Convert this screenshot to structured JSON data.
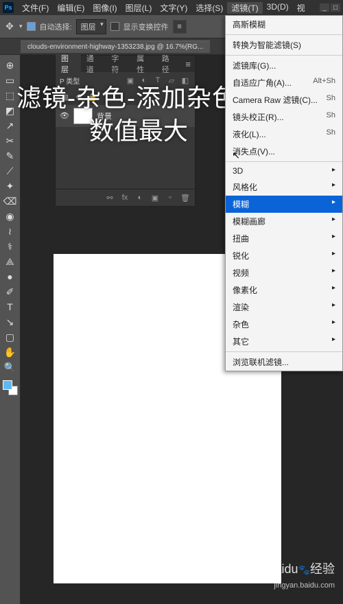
{
  "menubar": {
    "items": [
      "文件(F)",
      "编辑(E)",
      "图像(I)",
      "图层(L)",
      "文字(Y)",
      "选择(S)",
      "滤镜(T)",
      "3D(D)",
      "视"
    ],
    "active_index": 6
  },
  "optbar": {
    "auto_select": "自动选择:",
    "group": "图层",
    "show_transform": "显示变换控件"
  },
  "document_tab": "clouds-environment-highway-1353238.jpg @ 16.7%(RG...",
  "panel": {
    "tabs": [
      "图层",
      "通道",
      "字符",
      "属性",
      "路径"
    ],
    "kind": "Ρ 类型",
    "layer_name": "背景"
  },
  "dropdown": {
    "items": [
      {
        "label": "高斯模糊",
        "sep_after": true
      },
      {
        "label": "转换为智能滤镜(S)",
        "sep_after": true
      },
      {
        "label": "滤镜库(G)..."
      },
      {
        "label": "自适应广角(A)...",
        "shortcut": "Alt+Sh"
      },
      {
        "label": "Camera Raw 滤镜(C)...",
        "shortcut": "Sh"
      },
      {
        "label": "镜头校正(R)...",
        "shortcut": "Sh"
      },
      {
        "label": "液化(L)...",
        "shortcut": "Sh"
      },
      {
        "label": "消失点(V)...",
        "sep_after": true
      },
      {
        "label": "3D",
        "arrow": true
      },
      {
        "label": "风格化",
        "arrow": true
      },
      {
        "label": "模糊",
        "arrow": true,
        "highlight": true
      },
      {
        "label": "模糊画廊",
        "arrow": true
      },
      {
        "label": "扭曲",
        "arrow": true
      },
      {
        "label": "锐化",
        "arrow": true
      },
      {
        "label": "视频",
        "arrow": true
      },
      {
        "label": "像素化",
        "arrow": true
      },
      {
        "label": "渲染",
        "arrow": true
      },
      {
        "label": "杂色",
        "arrow": true
      },
      {
        "label": "其它",
        "arrow": true,
        "sep_after": true
      },
      {
        "label": "浏览联机滤镜..."
      }
    ]
  },
  "overlay": {
    "line1": "滤镜-杂色-添加杂色",
    "line2": "数值最大"
  },
  "watermark": {
    "brand": "Baidu",
    "label": "经验",
    "url": "jingyan.baidu.com"
  },
  "tools": [
    "⊕",
    "▭",
    "⬚",
    "◩",
    "↗",
    "✂",
    "✎",
    "⟋",
    "✦",
    "⌫",
    "◉",
    "≀",
    "⚕",
    "⟁",
    "●",
    "✐",
    "T",
    "↘",
    "▢",
    "✋",
    "🔍"
  ]
}
